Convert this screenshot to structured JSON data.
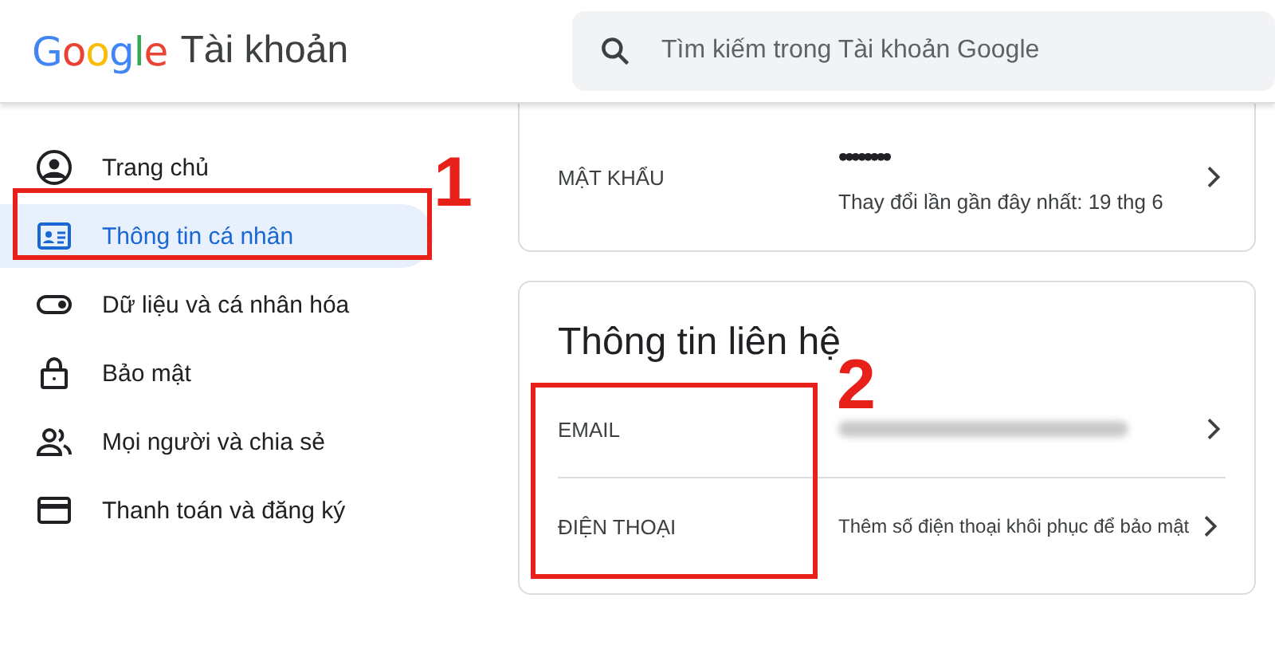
{
  "header": {
    "logo": "Google",
    "product": "Tài khoản",
    "search": {
      "placeholder": "Tìm kiếm trong Tài khoản Google"
    }
  },
  "sidebar": {
    "items": [
      {
        "label": "Trang chủ",
        "selected": false
      },
      {
        "label": "Thông tin cá nhân",
        "selected": true
      },
      {
        "label": "Dữ liệu và cá nhân hóa",
        "selected": false
      },
      {
        "label": "Bảo mật",
        "selected": false
      },
      {
        "label": "Mọi người và chia sẻ",
        "selected": false
      },
      {
        "label": "Thanh toán và đăng ký",
        "selected": false
      }
    ]
  },
  "password_card": {
    "label": "MẬT KHẨU",
    "value": "••••••••",
    "note": "Thay đổi lần gần đây nhất: 19 thg 6"
  },
  "contact_card": {
    "title": "Thông tin liên hệ",
    "rows": [
      {
        "label": "EMAIL",
        "redacted": true
      },
      {
        "label": "ĐIỆN THOẠI",
        "value": "Thêm số điện thoại khôi phục để bảo mật",
        "redacted": false
      }
    ]
  },
  "annotations": [
    {
      "number": "1"
    },
    {
      "number": "2"
    }
  ]
}
